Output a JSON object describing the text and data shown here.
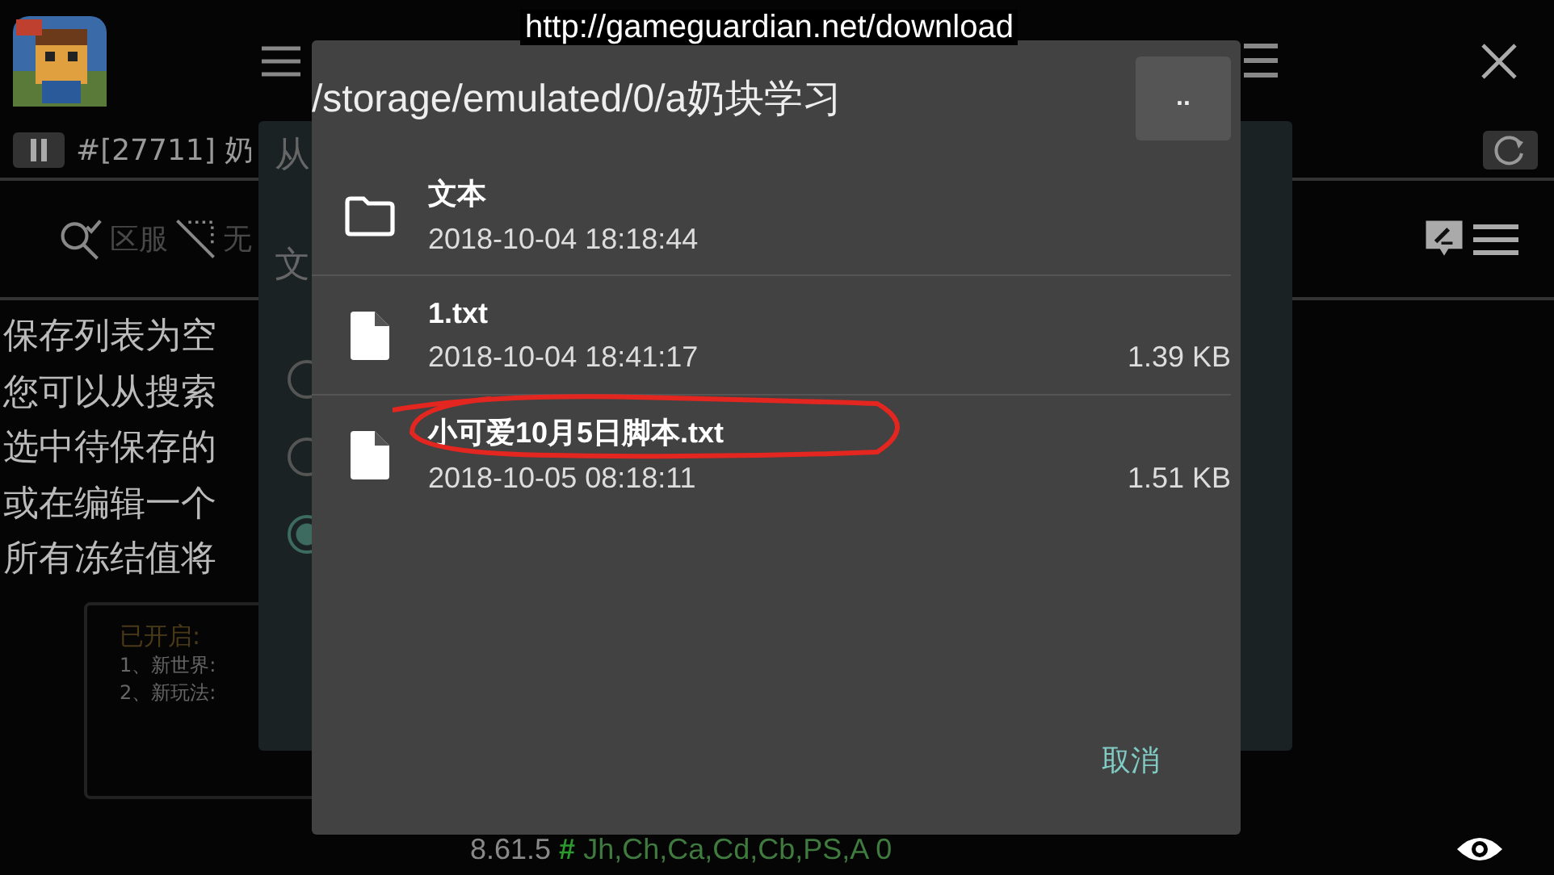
{
  "url_banner": "http://gameguardian.net/download",
  "header": {
    "process": "#[27711] 奶"
  },
  "background_text": {
    "dim_labels": [
      "区服",
      "无"
    ],
    "lines": [
      "保存列表为空",
      "您可以从搜索",
      "选中待保存的",
      "或在编辑一个",
      "所有冻结值将"
    ],
    "notice": {
      "title": "已开启:",
      "lines": [
        "1、新世界:",
        "2、新玩法:"
      ]
    }
  },
  "back_dialog": {
    "title_fragment": "从",
    "label_fragment": "文",
    "radios": [
      {
        "selected": false
      },
      {
        "selected": false
      },
      {
        "selected": true
      }
    ]
  },
  "file_dialog": {
    "path": "/storage/emulated/0/a奶块学习",
    "up_button": "..",
    "entries": [
      {
        "kind": "folder",
        "name": "文本",
        "date": "2018-10-04 18:18:44"
      },
      {
        "kind": "file",
        "name": "1.txt",
        "date": "2018-10-04 18:41:17",
        "size": "1.39 KB"
      },
      {
        "kind": "file",
        "name": "小可爱10月5日脚本.txt",
        "date": "2018-10-05 08:18:11",
        "size": "1.51 KB"
      }
    ],
    "cancel": "取消"
  },
  "status": {
    "version": "8.61.5",
    "hash": "#",
    "flags": "Jh,Ch,Ca,Cd,Cb,PS,A 0"
  }
}
